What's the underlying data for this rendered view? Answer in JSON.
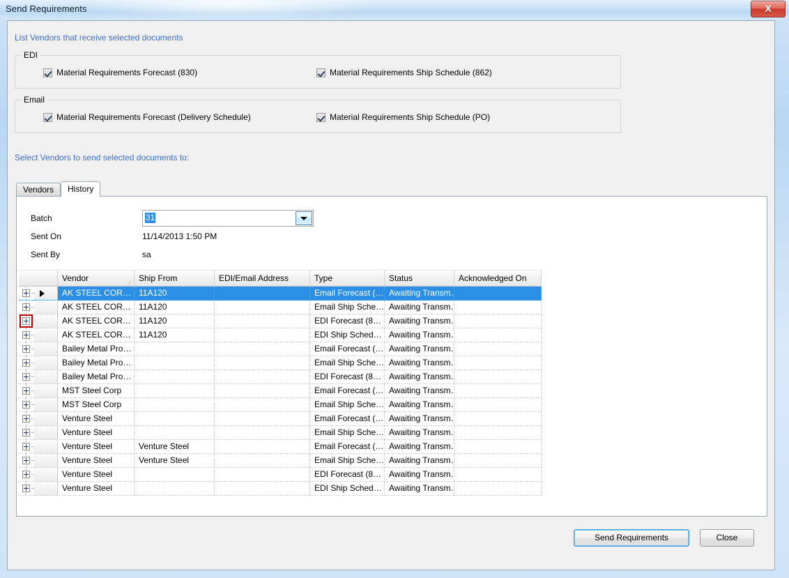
{
  "window": {
    "title": "Send Requirements",
    "close_label": "X"
  },
  "header": {
    "intro_label": "List Vendors that receive selected documents",
    "select_vendors_label": "Select Vendors to send selected documents to:"
  },
  "groups": [
    {
      "title": "EDI",
      "checkboxes": [
        {
          "label": "Material Requirements Forecast (830)",
          "checked": true
        },
        {
          "label": "Material Requirements Ship Schedule (862)",
          "checked": true
        }
      ]
    },
    {
      "title": "Email",
      "checkboxes": [
        {
          "label": "Material Requirements Forecast (Delivery Schedule)",
          "checked": true
        },
        {
          "label": "Material Requirements Ship Schedule (PO)",
          "checked": true
        }
      ]
    }
  ],
  "tabs": [
    {
      "label": "Vendors",
      "active": false
    },
    {
      "label": "History",
      "active": true
    }
  ],
  "history_form": {
    "batch_label": "Batch",
    "batch_value": "31",
    "sent_on_label": "Sent On",
    "sent_on_value": "11/14/2013 1:50 PM",
    "sent_by_label": "Sent By",
    "sent_by_value": "sa"
  },
  "grid": {
    "columns": [
      {
        "key": "vendor",
        "label": "Vendor",
        "sorted": "asc"
      },
      {
        "key": "ship_from",
        "label": "Ship From"
      },
      {
        "key": "address",
        "label": "EDI/Email Address"
      },
      {
        "key": "type",
        "label": "Type"
      },
      {
        "key": "status",
        "label": "Status"
      },
      {
        "key": "acknowledged_on",
        "label": "Acknowledged On"
      }
    ],
    "rows": [
      {
        "vendor": "AK STEEL COR…",
        "ship_from": "11A120",
        "address": "",
        "type": "Email Forecast (…",
        "status": "Awaiting  Transm…",
        "acknowledged_on": "",
        "selected": true,
        "marker": true,
        "highlight": false
      },
      {
        "vendor": "AK STEEL COR…",
        "ship_from": "11A120",
        "address": "",
        "type": "Email Ship Sche…",
        "status": "Awaiting  Transm…",
        "acknowledged_on": "",
        "selected": false,
        "marker": false,
        "highlight": false
      },
      {
        "vendor": "AK STEEL COR…",
        "ship_from": "11A120",
        "address": "",
        "type": "EDI Forecast (8…",
        "status": "Awaiting  Transm…",
        "acknowledged_on": "",
        "selected": false,
        "marker": false,
        "highlight": true
      },
      {
        "vendor": "AK STEEL COR…",
        "ship_from": "11A120",
        "address": "",
        "type": "EDI Ship Sched…",
        "status": "Awaiting  Transm…",
        "acknowledged_on": "",
        "selected": false,
        "marker": false,
        "highlight": false
      },
      {
        "vendor": "Bailey Metal Pro…",
        "ship_from": "",
        "address": "",
        "type": "Email Forecast (…",
        "status": "Awaiting  Transm…",
        "acknowledged_on": "",
        "selected": false,
        "marker": false,
        "highlight": false
      },
      {
        "vendor": "Bailey Metal Pro…",
        "ship_from": "",
        "address": "",
        "type": "Email Ship Sche…",
        "status": "Awaiting  Transm…",
        "acknowledged_on": "",
        "selected": false,
        "marker": false,
        "highlight": false
      },
      {
        "vendor": "Bailey Metal Pro…",
        "ship_from": "",
        "address": "",
        "type": "EDI Forecast (8…",
        "status": "Awaiting  Transm…",
        "acknowledged_on": "",
        "selected": false,
        "marker": false,
        "highlight": false
      },
      {
        "vendor": "MST Steel Corp",
        "ship_from": "",
        "address": "",
        "type": "Email Forecast (…",
        "status": "Awaiting  Transm…",
        "acknowledged_on": "",
        "selected": false,
        "marker": false,
        "highlight": false
      },
      {
        "vendor": "MST Steel Corp",
        "ship_from": "",
        "address": "",
        "type": "Email Ship Sche…",
        "status": "Awaiting  Transm…",
        "acknowledged_on": "",
        "selected": false,
        "marker": false,
        "highlight": false
      },
      {
        "vendor": "Venture Steel",
        "ship_from": "",
        "address": "",
        "type": "Email Forecast (…",
        "status": "Awaiting  Transm…",
        "acknowledged_on": "",
        "selected": false,
        "marker": false,
        "highlight": false
      },
      {
        "vendor": "Venture Steel",
        "ship_from": "",
        "address": "",
        "type": "Email Ship Sche…",
        "status": "Awaiting  Transm…",
        "acknowledged_on": "",
        "selected": false,
        "marker": false,
        "highlight": false
      },
      {
        "vendor": "Venture Steel",
        "ship_from": "Venture Steel",
        "address": "",
        "type": "Email Forecast (…",
        "status": "Awaiting  Transm…",
        "acknowledged_on": "",
        "selected": false,
        "marker": false,
        "highlight": false
      },
      {
        "vendor": "Venture Steel",
        "ship_from": "Venture Steel",
        "address": "",
        "type": "Email Ship Sche…",
        "status": "Awaiting  Transm…",
        "acknowledged_on": "",
        "selected": false,
        "marker": false,
        "highlight": false
      },
      {
        "vendor": "Venture Steel",
        "ship_from": "",
        "address": "",
        "type": "EDI Forecast (8…",
        "status": "Awaiting  Transm…",
        "acknowledged_on": "",
        "selected": false,
        "marker": false,
        "highlight": false
      },
      {
        "vendor": "Venture Steel",
        "ship_from": "",
        "address": "",
        "type": "EDI Ship Sched…",
        "status": "Awaiting  Transm…",
        "acknowledged_on": "",
        "selected": false,
        "marker": false,
        "highlight": false
      }
    ]
  },
  "footer": {
    "send_label": "Send Requirements",
    "close_label": "Close"
  },
  "colors": {
    "selection_blue": "#2a8fe5",
    "link_blue": "#3f6fc4",
    "highlight_red": "#c00000",
    "titlebar_blue": "#bcd9f2"
  }
}
